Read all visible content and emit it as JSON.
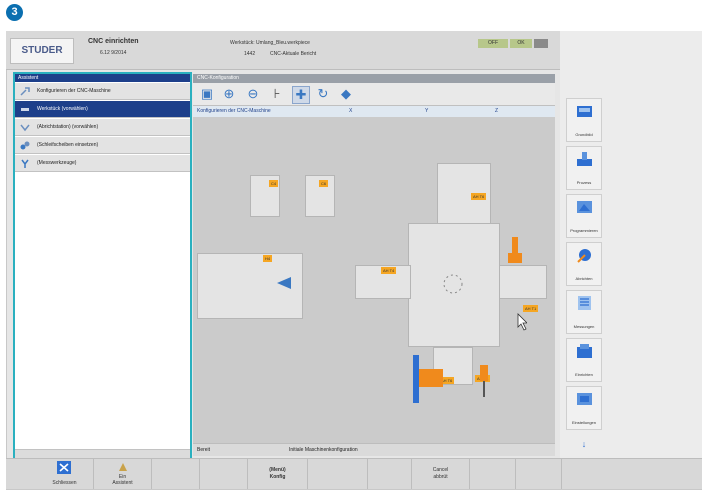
{
  "step_badge": "3",
  "header": {
    "logo": "STUDER",
    "app_title": "CNC einrichten",
    "app_subtitle": "6.12 9/2014",
    "workpiece_label": "Werkstück: Umlang_Bleu.werkpiece",
    "workpiece_sub": "1442",
    "program_label": "CNC-Aktuale Bericht",
    "status_pills": [
      "OFF",
      "OK"
    ]
  },
  "left_panel": {
    "title": "Assistent",
    "items": [
      {
        "label": "Konfigurieren der CNC-Maschine",
        "selected": false
      },
      {
        "label": "Werkstück (vorwählen)",
        "selected": true
      },
      {
        "label": "(Abrichtstation) (vorwählen)",
        "selected": false
      },
      {
        "label": "(Schleifscheiben einsetzen)",
        "selected": false
      },
      {
        "label": "(Messwerkzeuge)",
        "selected": false
      }
    ]
  },
  "main": {
    "title": "CNC-Konfiguration",
    "subheader": "Konfigurieren der CNC-Maschine",
    "col_x": "X",
    "col_y": "Y",
    "col_z": "Z",
    "labels": [
      "C4",
      "C6",
      "H4",
      "AH T6",
      "AH T4",
      "AH T1",
      "AH T6",
      "AH T4"
    ],
    "status_left": "Bereit",
    "status_center": "Initiale Maschinenkonfiguration"
  },
  "right_buttons": [
    {
      "label": "Grundbild",
      "icon": "machine-icon"
    },
    {
      "label": "Prozess",
      "icon": "process-icon"
    },
    {
      "label": "Programmieren",
      "icon": "program-icon"
    },
    {
      "label": "Abrichten",
      "icon": "dress-icon"
    },
    {
      "label": "Messungen",
      "icon": "measure-icon"
    },
    {
      "label": "Einrichten",
      "icon": "setup-icon"
    },
    {
      "label": "Einstellungen",
      "icon": "settings-icon"
    }
  ],
  "right_more": "↓",
  "bottom": {
    "close_label": "Schliessen",
    "assistant_label": "Ein\nAssistent",
    "menu_label": "(Menü)\nKonfig",
    "cancel_label": "Cancel\nabbrüt"
  }
}
